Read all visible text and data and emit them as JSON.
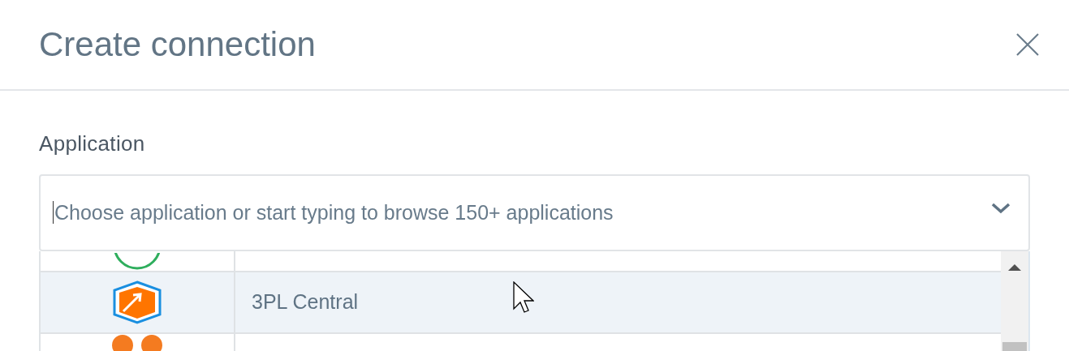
{
  "dialog": {
    "title": "Create connection"
  },
  "field": {
    "label": "Application",
    "placeholder": "Choose application or start typing to browse 150+ applications"
  },
  "options": [
    {
      "kind": "ring",
      "selected": false
    },
    {
      "kind": "box",
      "name": "3PL Central",
      "selected": true
    },
    {
      "kind": "dots",
      "selected": false
    }
  ]
}
